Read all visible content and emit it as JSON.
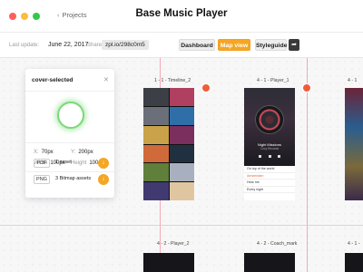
{
  "window": {
    "back_label": "Projects",
    "title": "Base Music Player"
  },
  "toolbar": {
    "last_update_label": "Last update:",
    "last_update_value": "June 22, 2017",
    "share_label": "Share:",
    "share_link": "zpl.io/298c0m5",
    "buttons": [
      {
        "label": "Dashboard",
        "active": false
      },
      {
        "label": "Map view",
        "active": true
      },
      {
        "label": "Styleguide",
        "active": false
      }
    ]
  },
  "panel": {
    "title": "cover-selected",
    "x_label": "X:",
    "x_value": "70px",
    "y_label": "Y:",
    "y_value": "200px",
    "width_label": "Width",
    "width_value": "100px",
    "height_label": "Height",
    "height_value": "100px",
    "assets": [
      {
        "format": "PNG",
        "desc": "3 Bitmap assets"
      },
      {
        "format": "PDF",
        "desc": "1 asset"
      }
    ]
  },
  "artboards": {
    "a1": "1 - 1 - Timeline_2",
    "a2": "4 - 1 - Player_1",
    "a3": "4 - 2 - Player_2",
    "a4": "4 - 2 - Coach_mark",
    "a5": "4 - 1 -",
    "a6": "4 - 1"
  },
  "player": {
    "now_playing": "Night Missions",
    "artist": "Cozy Records",
    "list": [
      "On top of the world",
      "Amsterdam",
      "Hear me",
      "Every night"
    ],
    "active_index": 1
  },
  "colors": {
    "accent": "#f5a623",
    "badge": "#ee5d3a",
    "selection_glow": "#7ad978",
    "guide": "#f3a9b4"
  },
  "album_colors": [
    "#3c3f46",
    "#b04060",
    "#6b6f7a",
    "#2f6fa8",
    "#c9a24a",
    "#7a2f5f",
    "#d06a3a",
    "#203040",
    "#5f7f3a",
    "#a8b0c0",
    "#403a70",
    "#e0c6a0"
  ]
}
